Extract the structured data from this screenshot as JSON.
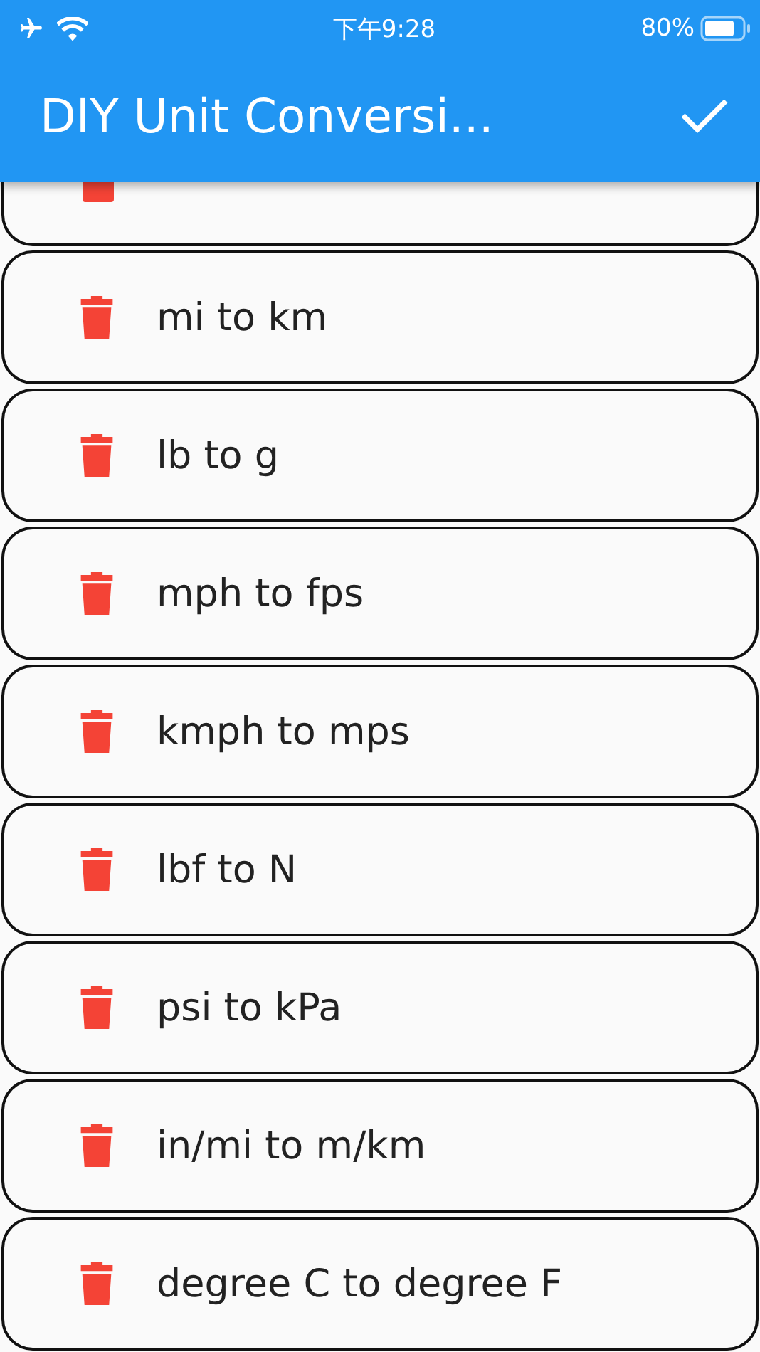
{
  "status_bar": {
    "time": "下午9:28",
    "battery": "80%"
  },
  "app_bar": {
    "title": "DIY Unit Conversi..."
  },
  "rows": [
    {
      "kind": "partial"
    },
    {
      "label": "mi to km"
    },
    {
      "label": "lb to g"
    },
    {
      "label": "mph to fps"
    },
    {
      "label": "kmph to mps"
    },
    {
      "label": "lbf to N"
    },
    {
      "label": "psi to kPa"
    },
    {
      "label": "in/mi to m/km"
    },
    {
      "label": "degree C to degree F"
    }
  ]
}
